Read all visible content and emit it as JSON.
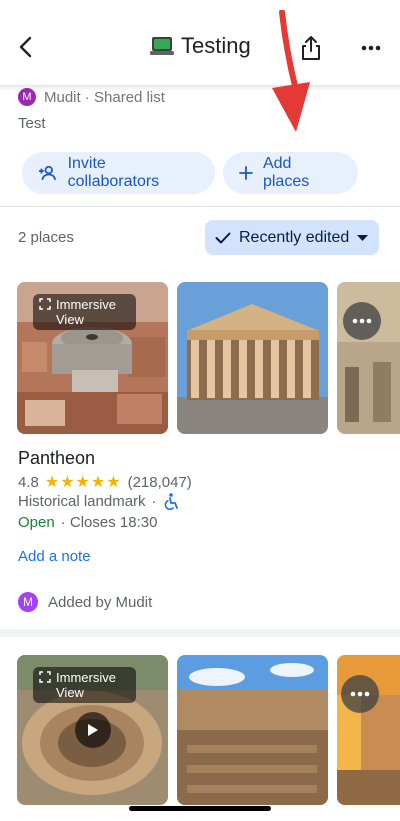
{
  "header": {
    "title": "Testing",
    "back_icon": "chevron-left-icon",
    "share_icon": "share-icon",
    "more_icon": "more-horizontal-icon"
  },
  "list": {
    "owner_avatar": "M",
    "owner_text": "Mudit · Shared list",
    "description": "Test"
  },
  "actions": {
    "invite_label": "Invite collaborators",
    "add_places_label": "Add places"
  },
  "summary": {
    "count": "2 places",
    "sort_label": "Recently edited"
  },
  "places": [
    {
      "name": "Pantheon",
      "rating": "4.8",
      "stars": "★★★★★",
      "reviews": "(218,047)",
      "category": "Historical landmark",
      "dot": "·",
      "open": "Open",
      "closes": "· Closes 18:30",
      "add_note": "Add a note",
      "added_avatar": "M",
      "added_by": "Added by Mudit",
      "immersive_label": "Immersive View"
    },
    {
      "immersive_label": "Immersive View"
    }
  ],
  "colors": {
    "accent": "#1a73e8",
    "chip_bg": "#e8f0fe",
    "sort_bg": "#d3e3fd",
    "open_green": "#188038",
    "star": "#f4b400",
    "arrow_red": "#e53935"
  }
}
